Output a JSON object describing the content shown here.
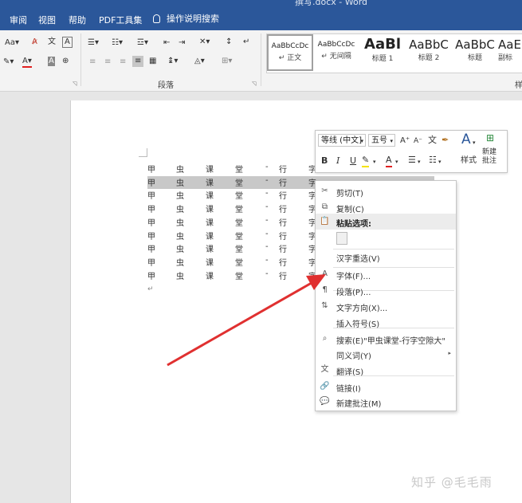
{
  "window": {
    "title": "撰写.docx - Word"
  },
  "menubar": {
    "tabs": [
      "审阅",
      "视图",
      "帮助",
      "PDF工具集"
    ],
    "tell_me": "操作说明搜索"
  },
  "ribbon": {
    "paragraph_group_label": "段落",
    "styles_group_label": "样",
    "font_aa_label": "Aa",
    "styles": [
      {
        "sample": "AaBbCcDc",
        "name": "正文",
        "selected": true
      },
      {
        "sample": "AaBbCcDc",
        "name": "无间隔",
        "selected": false
      },
      {
        "sample": "AaBl",
        "name": "标题 1",
        "selected": false
      },
      {
        "sample": "AaBbC",
        "name": "标题 2",
        "selected": false
      },
      {
        "sample": "AaBbC",
        "name": "标题",
        "selected": false
      },
      {
        "sample": "AaE",
        "name": "副标",
        "selected": false
      }
    ]
  },
  "document": {
    "row_chars": [
      "甲",
      "虫",
      "课",
      "堂",
      "-",
      "行",
      "字"
    ],
    "row_count": 9,
    "highlighted_row": 1
  },
  "mini_toolbar": {
    "font_name": "等线 (中文]",
    "font_size": "五号",
    "styles_label": "样式",
    "new_comment_label": "新建\n批注",
    "bold": "B",
    "italic": "I",
    "underline": "U"
  },
  "context_menu": {
    "items": [
      {
        "label": "剪切(T)",
        "icon": "scissors-icon",
        "glyph": "✂"
      },
      {
        "label": "复制(C)",
        "icon": "copy-icon",
        "glyph": "⧉"
      },
      {
        "label": "粘贴选项:",
        "icon": "paste-icon",
        "glyph": "📋",
        "header": true
      },
      {
        "label": "汉字重选(V)",
        "icon": "",
        "glyph": ""
      },
      {
        "label": "字体(F)...",
        "icon": "font-icon",
        "glyph": "A"
      },
      {
        "label": "段落(P)...",
        "icon": "paragraph-icon",
        "glyph": "¶"
      },
      {
        "label": "文字方向(X)...",
        "icon": "text-direction-icon",
        "glyph": "⇅"
      },
      {
        "label": "插入符号(S)",
        "icon": "",
        "glyph": ""
      },
      {
        "label": "搜索(E)\"甲虫课堂-行字空隙大\"",
        "icon": "search-icon",
        "glyph": "⌕"
      },
      {
        "label": "同义词(Y)",
        "icon": "",
        "glyph": "",
        "submenu": true
      },
      {
        "label": "翻译(S)",
        "icon": "translate-icon",
        "glyph": "文"
      },
      {
        "label": "链接(I)",
        "icon": "link-icon",
        "glyph": "🔗"
      },
      {
        "label": "新建批注(M)",
        "icon": "comment-icon",
        "glyph": "💬"
      }
    ]
  },
  "watermark": "知乎 @毛毛雨",
  "colors": {
    "ribbon_blue": "#2b579a",
    "arrow_red": "#e03030",
    "highlight_gray": "#c8c8c8"
  }
}
